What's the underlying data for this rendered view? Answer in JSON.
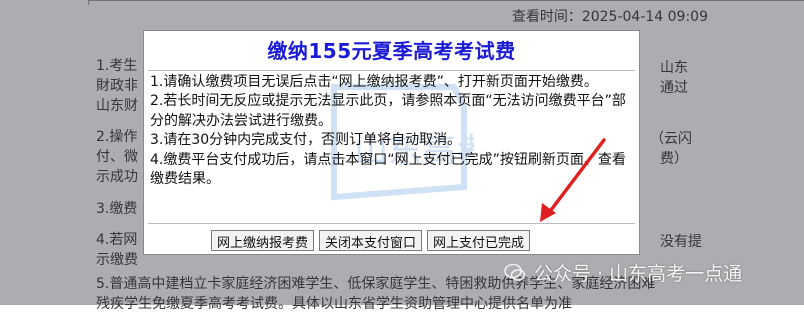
{
  "background": {
    "view_time_label": "查看时间：2025-04-14 09:09",
    "lines": [
      "1.考生",
      "財政非",
      "山东财",
      "2.操作",
      "付、微",
      "示成功",
      "3.缴费",
      "4.若网",
      "示缴费",
      "5.普通高中建档立卡家庭经济困难学生、低保家庭学生、特困救助供养学生、家庭经济困难",
      "残疾学生免缴夏季高考考试费。具体以山东省学生资助管理中心提供名单为准"
    ],
    "right_fragments": [
      "山东",
      "通过",
      "（云闪",
      "费）",
      "没有提"
    ]
  },
  "watermark": {
    "text": "公众号 · 山东高考一点通",
    "logo_text": "山东高考"
  },
  "modal": {
    "title": "缴纳155元夏季高考考试费",
    "instructions": [
      "1.请确认缴费项目无误后点击“网上缴纳报考费”、打开新页面开始缴费。",
      "2.若长时间无反应或提示无法显示此页，请参照本页面“无法访问缴费平台”部分的解决办法尝试进行缴费。",
      "3.请在30分钟内完成支付，否则订单将自动取消。",
      "4.缴费平台支付成功后，请点击本窗口“网上支付已完成”按钮刷新页面、查看缴费结果。"
    ],
    "buttons": {
      "pay_online": "网上缴纳报考费",
      "close_window": "关闭本支付窗口",
      "payment_done": "网上支付已完成"
    }
  },
  "colors": {
    "title": "#1b1bd6",
    "arrow": "#e02020",
    "overlay": "rgba(60,60,70,0.42)"
  }
}
